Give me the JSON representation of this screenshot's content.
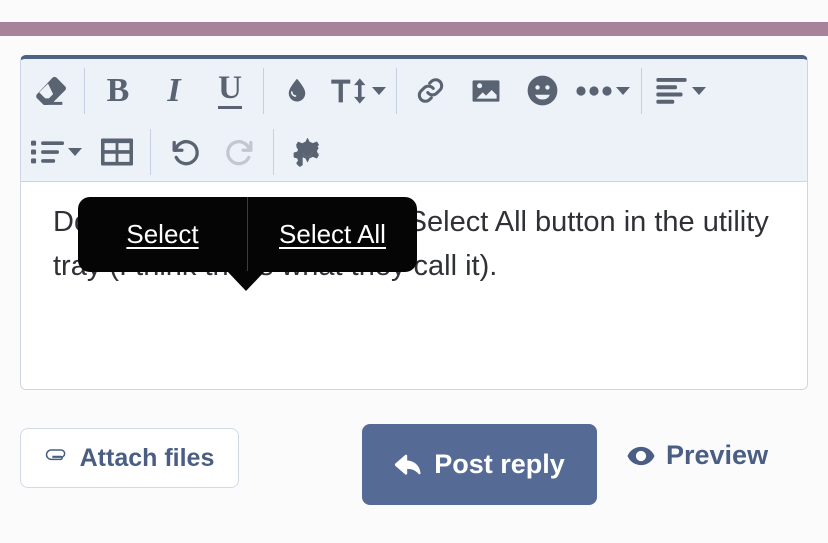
{
  "theme": {
    "top_bar_color": "#a8819a",
    "accent_button_color": "#556b95",
    "accent_text_color": "#4a5d82",
    "toolbar_bg": "#edf1f8",
    "editor_focus_border": "#4e6285",
    "menu_bg": "#050505"
  },
  "toolbar": {
    "row1": [
      {
        "name": "clear-formatting-icon",
        "label": "Remove formatting",
        "icon": "eraser",
        "caret": false,
        "disabled": false
      },
      {
        "name": "bold-button",
        "label": "B",
        "icon": "bold",
        "caret": false,
        "disabled": false
      },
      {
        "name": "italic-button",
        "label": "I",
        "icon": "italic",
        "caret": false,
        "disabled": false
      },
      {
        "name": "underline-button",
        "label": "U",
        "icon": "underline",
        "caret": false,
        "disabled": false
      },
      {
        "name": "text-color-button",
        "label": "Text color",
        "icon": "droplet",
        "caret": false,
        "disabled": false
      },
      {
        "name": "font-size-button",
        "label": "Font size",
        "icon": "text-size",
        "caret": true,
        "disabled": false
      },
      {
        "name": "insert-link-button",
        "label": "Link",
        "icon": "link",
        "caret": false,
        "disabled": false
      },
      {
        "name": "insert-image-button",
        "label": "Image",
        "icon": "image",
        "caret": false,
        "disabled": false
      },
      {
        "name": "insert-emoji-button",
        "label": "Smilies",
        "icon": "smiley",
        "caret": false,
        "disabled": false
      },
      {
        "name": "more-options-button",
        "label": "More options",
        "icon": "ellipsis",
        "caret": true,
        "disabled": false
      },
      {
        "name": "text-align-button",
        "label": "Alignment",
        "icon": "align-left",
        "caret": true,
        "disabled": false
      }
    ],
    "row2": [
      {
        "name": "list-button",
        "label": "List",
        "icon": "bullet-list",
        "caret": true,
        "disabled": false
      },
      {
        "name": "insert-table-button",
        "label": "Table",
        "icon": "table",
        "caret": false,
        "disabled": false
      },
      {
        "name": "undo-button",
        "label": "Undo",
        "icon": "undo",
        "caret": false,
        "disabled": false
      },
      {
        "name": "redo-button",
        "label": "Redo",
        "icon": "redo",
        "caret": false,
        "disabled": true
      },
      {
        "name": "editor-settings-button",
        "label": "Editor settings",
        "icon": "gear",
        "caret": false,
        "disabled": false
      }
    ]
  },
  "composer": {
    "text": "Double-tap, then select the Select All button in the utility tray (I think that’s what they call it)."
  },
  "selection_menu": {
    "items": [
      {
        "name": "selection-menu-select",
        "label": "Select"
      },
      {
        "name": "selection-menu-select-all",
        "label": "Select All"
      }
    ]
  },
  "actions": {
    "attach_files_label": "Attach files",
    "post_reply_label": "Post reply",
    "preview_label": "Preview"
  }
}
